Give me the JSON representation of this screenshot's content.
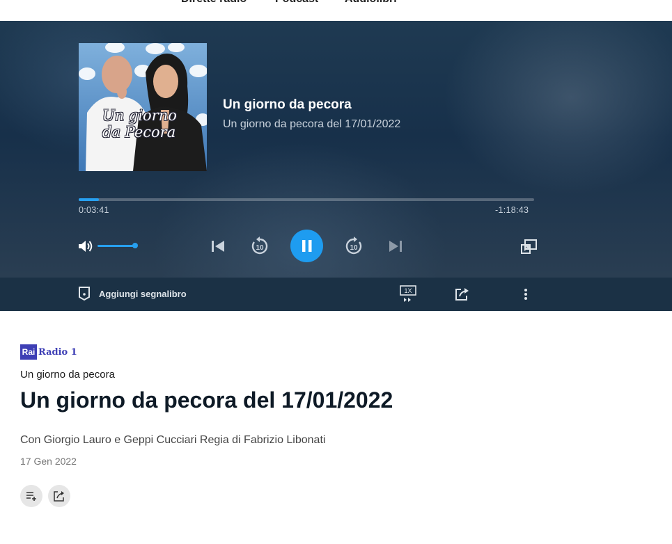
{
  "nav": {
    "items": [
      "Dirette radio",
      "Podcast",
      "Audiolibri"
    ]
  },
  "player": {
    "show_title": "Un giorno da pecora",
    "episode_title": "Un giorno da pecora del 17/01/2022",
    "cover_text_line1": "Un giorno",
    "cover_text_line2": "da Pecora",
    "elapsed": "0:03:41",
    "remaining": "-1:18:43",
    "progress": 0.045,
    "volume": 0.95,
    "speed_label": "1X",
    "bookmark_label": "Aggiungi segnalibro",
    "icons": [
      "volume-icon",
      "skip-previous-icon",
      "rewind-10-icon",
      "pause-icon",
      "forward-10-icon",
      "skip-next-icon",
      "picture-in-picture-icon",
      "bookmark-icon",
      "speed-icon",
      "share-icon",
      "more-vertical-icon"
    ],
    "accent_color": "#1e9cf0"
  },
  "content": {
    "logo_text": "Rai",
    "channel": "Radio 1",
    "program": "Un giorno da pecora",
    "title": "Un giorno da pecora del 17/01/2022",
    "description": "Con Giorgio Lauro e Geppi Cucciari Regia di Fabrizio Libonati",
    "date": "17 Gen 2022",
    "brand_color": "#3e3fb5"
  }
}
